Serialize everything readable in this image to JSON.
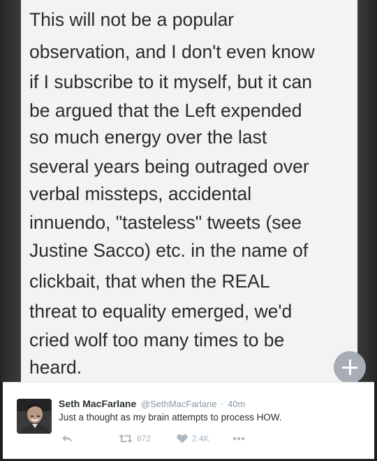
{
  "note": {
    "lines": [
      "This will not be a popular",
      "observation, and I don't even know",
      "if I subscribe to it myself, but it can",
      "be argued that the Left expended",
      "so much energy over the last",
      "several years being outraged over",
      "verbal missteps, accidental",
      "innuendo, \"tasteless\" tweets (see",
      "Justine Sacco) etc. in the name of",
      "clickbait, that when the REAL",
      "threat to equality emerged, we'd",
      "cried wolf too many times to be",
      "heard."
    ],
    "fab_icon": "plus-icon"
  },
  "tweet": {
    "display_name": "Seth MacFarlane",
    "handle": "@SethMacFarlane",
    "separator": "·",
    "time": "40m",
    "text": "Just a thought as my brain attempts to process HOW.",
    "actions": {
      "reply_icon": "reply-icon",
      "retweet_icon": "retweet-icon",
      "retweet_count": "872",
      "like_icon": "heart-icon",
      "like_count": "2.4K",
      "more_icon": "more-icon"
    }
  },
  "colors": {
    "note_background": "#f3f3f3",
    "note_text": "#2a2a2a",
    "fab": "#a7adb5",
    "muted": "#8899a6",
    "action_icon": "#aab8c2"
  }
}
